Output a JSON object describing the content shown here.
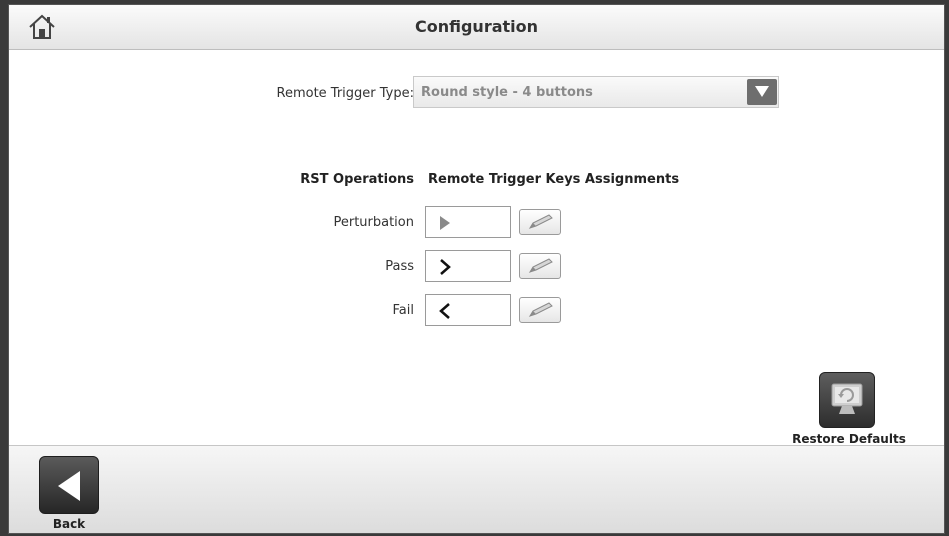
{
  "header": {
    "title": "Configuration",
    "home_icon": "home-icon"
  },
  "trigger": {
    "label": "Remote Trigger Type:",
    "selected": "Round style - 4 buttons",
    "dropdown_icon": "triangle-down-icon"
  },
  "table": {
    "col_operations": "RST Operations",
    "col_assignments": "Remote Trigger Keys Assignments",
    "rows": [
      {
        "label": "Perturbation",
        "key_icon": "play-triangle-icon"
      },
      {
        "label": "Pass",
        "key_icon": "chevron-right-icon"
      },
      {
        "label": "Fail",
        "key_icon": "chevron-left-icon"
      }
    ],
    "edit_icon": "pencil-icon"
  },
  "restore": {
    "label": "Restore Defaults",
    "icon": "monitor-refresh-icon"
  },
  "footer": {
    "back_label": "Back",
    "back_icon": "back-triangle-icon"
  },
  "colors": {
    "background": "#ffffff",
    "button_dark": "#3a3a3a",
    "muted_text": "#8a8a8a"
  }
}
